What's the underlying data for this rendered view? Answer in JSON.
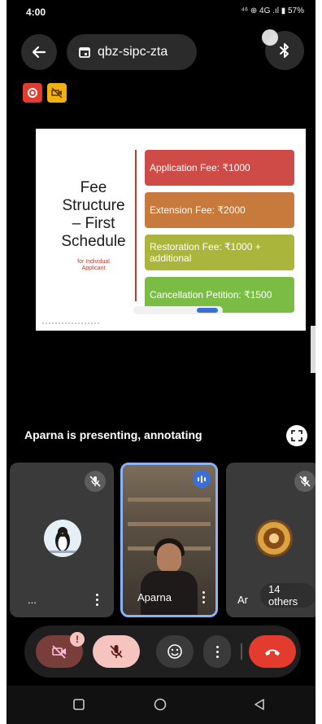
{
  "status_bar": {
    "time": "4:00",
    "indicators": "⁴⁶ ⊕ 4G .ıl ▮ 57%"
  },
  "top_bar": {
    "meeting_code": "qbz-sipc-zta"
  },
  "slide": {
    "title_lines": [
      "Fee",
      "Structure",
      "– First",
      "Schedule"
    ],
    "subtitle_lines": [
      "for Individual",
      "Applicant"
    ],
    "fees": [
      "Application Fee: ₹1000",
      "Extension Fee: ₹2000",
      "Restoration Fee: ₹1000 + additional",
      "Cancellation Petition: ₹1500"
    ]
  },
  "presenting_text": "Aparna is presenting, annotating",
  "tiles": [
    {
      "name": "..."
    },
    {
      "name": "Aparna"
    },
    {
      "name": "Ar"
    }
  ],
  "others_chip": "14 others",
  "colors": {
    "end_call": "#e33b2e",
    "mic_off": "#f6c4bf",
    "cam_off": "#7a3e3a",
    "active_border": "#8ab4f8"
  }
}
